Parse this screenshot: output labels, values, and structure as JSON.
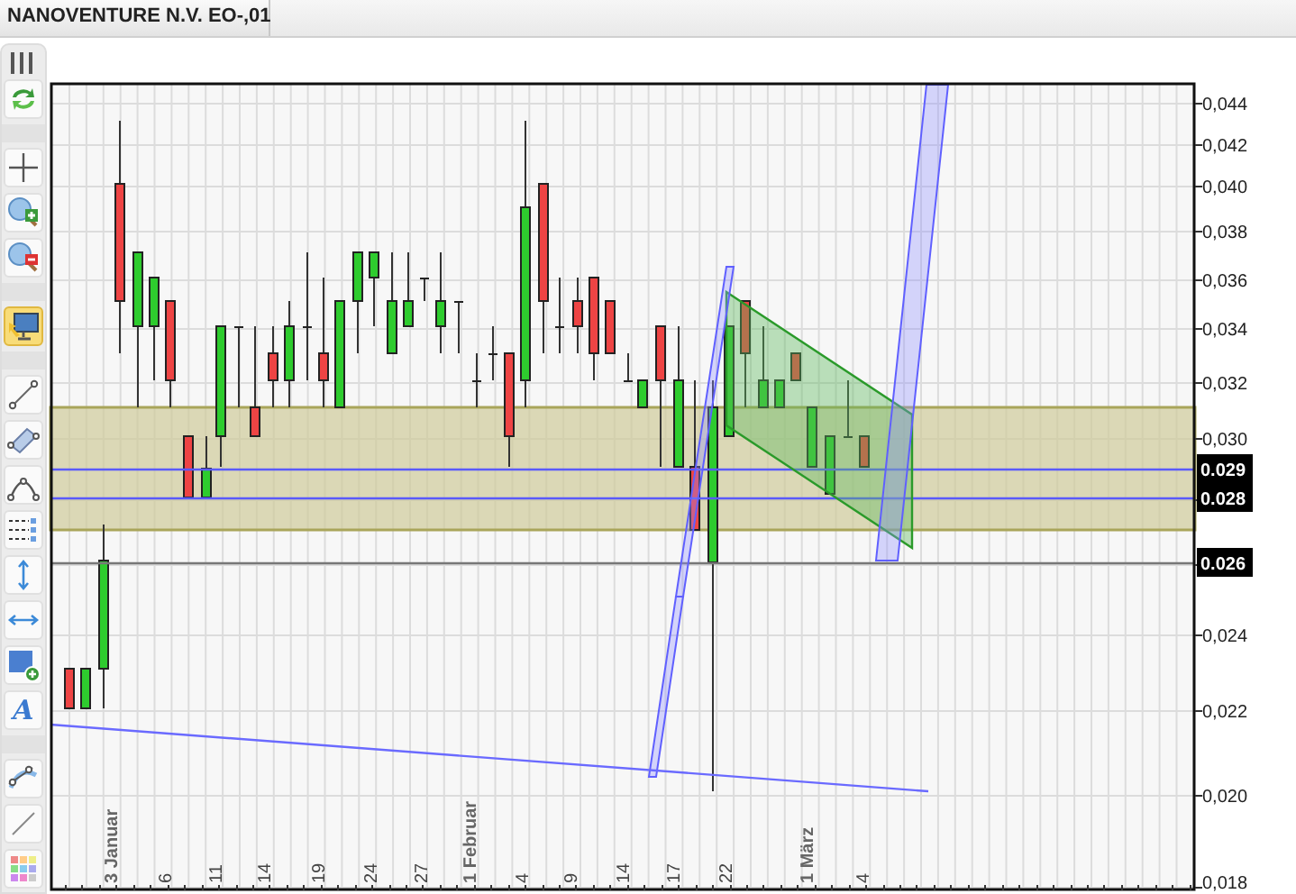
{
  "tab": {
    "title": "NANOVENTURE N.V. EO-,01"
  },
  "toolbar": {
    "tools": [
      {
        "kind": "refresh",
        "selected": false
      },
      {
        "kind": "separator"
      },
      {
        "kind": "crosshair",
        "selected": false
      },
      {
        "kind": "zoomin",
        "selected": false
      },
      {
        "kind": "zoomout",
        "selected": false
      },
      {
        "kind": "separator"
      },
      {
        "kind": "display",
        "selected": true
      },
      {
        "kind": "separator"
      },
      {
        "kind": "line",
        "selected": false
      },
      {
        "kind": "channel",
        "selected": false
      },
      {
        "kind": "arc",
        "selected": false
      },
      {
        "kind": "levels",
        "selected": false
      },
      {
        "kind": "vertical",
        "selected": false
      },
      {
        "kind": "horizontal",
        "selected": false
      },
      {
        "kind": "rectangle",
        "selected": false
      },
      {
        "kind": "text",
        "glyph": "A",
        "selected": false
      },
      {
        "kind": "separator"
      },
      {
        "kind": "curve",
        "selected": false
      },
      {
        "kind": "segment",
        "selected": false
      },
      {
        "kind": "palette",
        "selected": false
      }
    ]
  },
  "chart": {
    "y_axis_labels": [
      "0,044",
      "0,042",
      "0,040",
      "0,038",
      "0,036",
      "0,034",
      "0,032",
      "0,030",
      "0,024",
      "0,022",
      "0,020",
      "0,018"
    ],
    "price_markers": [
      "0.029",
      "0.028",
      "0.026"
    ],
    "x_axis_labels": [
      {
        "text": "3 Januar",
        "kind": "month"
      },
      {
        "text": "6",
        "kind": "day"
      },
      {
        "text": "11",
        "kind": "day"
      },
      {
        "text": "14",
        "kind": "day"
      },
      {
        "text": "19",
        "kind": "day"
      },
      {
        "text": "24",
        "kind": "day"
      },
      {
        "text": "27",
        "kind": "day"
      },
      {
        "text": "1 Februar",
        "kind": "month"
      },
      {
        "text": "4",
        "kind": "day"
      },
      {
        "text": "9",
        "kind": "day"
      },
      {
        "text": "14",
        "kind": "day"
      },
      {
        "text": "17",
        "kind": "day"
      },
      {
        "text": "22",
        "kind": "day"
      },
      {
        "text": "1 März",
        "kind": "month"
      },
      {
        "text": "4",
        "kind": "day"
      }
    ]
  }
}
